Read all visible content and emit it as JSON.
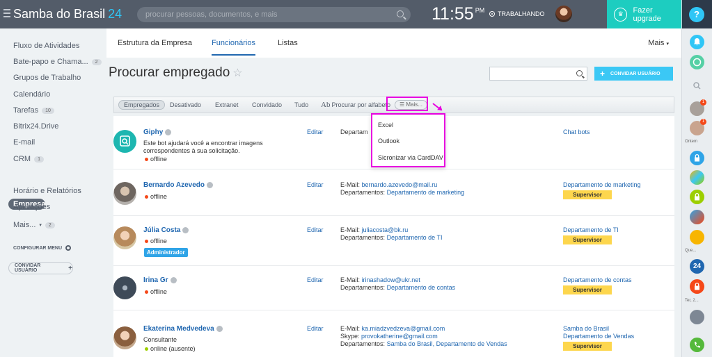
{
  "topbar": {
    "logo_name": "Samba do Brasil",
    "logo_num": "24",
    "search_placeholder": "procurar pessoas, documentos, e mais",
    "time": "11:55",
    "time_suffix": "PM",
    "work_status": "TRABALHANDO",
    "upgrade_label": "Fazer upgrade"
  },
  "rightbar": {
    "help": "?",
    "label_ontem": "Ontem",
    "label_que": "Que...",
    "label_ter": "Ter, 2...",
    "badge1": "1",
    "badge2": "1",
    "num24": "24"
  },
  "sidebar": {
    "items": [
      {
        "label": "Fluxo de Atividades",
        "count": ""
      },
      {
        "label": "Bate-papo e Chama...",
        "count": "2"
      },
      {
        "label": "Grupos de Trabalho",
        "count": ""
      },
      {
        "label": "Calendário",
        "count": ""
      },
      {
        "label": "Tarefas",
        "count": "10"
      },
      {
        "label": "Bitrix24.Drive",
        "count": ""
      },
      {
        "label": "E-mail",
        "count": ""
      },
      {
        "label": "CRM",
        "count": "1"
      },
      {
        "label": "Empresa",
        "count": ""
      },
      {
        "label": "Horário e Relatórios",
        "count": ""
      },
      {
        "label": "Aplicações",
        "count": ""
      },
      {
        "label": "Mais...",
        "count": "2"
      }
    ],
    "configure": "CONFIGURAR MENU",
    "invite": "CONVIDAR USUÁRIO"
  },
  "tabs": {
    "items": [
      "Estrutura da Empresa",
      "Funcionários",
      "Listas"
    ],
    "more": "Mais"
  },
  "page": {
    "title": "Procurar empregado",
    "invite_button": "CONVIDAR USUÁRIO"
  },
  "filters": {
    "items": [
      "Empregados",
      "Desativado",
      "Extranet",
      "Convidado",
      "Tudo"
    ],
    "alphabet": "Procurar por alfabeto",
    "more": "Mais..."
  },
  "dropdown": {
    "items": [
      "Excel",
      "Outlook",
      "Sicronizar via CardDAV"
    ]
  },
  "employees": [
    {
      "name": "Giphy",
      "desc": "Este bot ajudará você a encontrar imagens correspondentes à sua solicitação.",
      "status": "offline",
      "edit": "Editar",
      "dept_label": "Departam",
      "dept": "Chat bots"
    },
    {
      "name": "Bernardo Azevedo",
      "status": "offline",
      "edit": "Editar",
      "email_label": "E-Mail:",
      "email": "bernardo.azevedo@mail.ru",
      "depts_label": "Departamentos:",
      "depts": "Departamento de marketing",
      "dept": "Departamento de marketing",
      "badge": "Supervisor"
    },
    {
      "name": "Júlia Costa",
      "status": "offline",
      "role": "Administrador",
      "edit": "Editar",
      "email_label": "E-Mail:",
      "email": "juliacosta@bk.ru",
      "depts_label": "Departamentos:",
      "depts": "Departamento de TI",
      "dept": "Departamento de TI",
      "badge": "Supervisor"
    },
    {
      "name": "Irina Gr",
      "status": "offline",
      "edit": "Editar",
      "email_label": "E-Mail:",
      "email": "irinashadow@ukr.net",
      "depts_label": "Departamentos:",
      "depts": "Departamento de contas",
      "dept": "Departamento de contas",
      "badge": "Supervisor"
    },
    {
      "name": "Ekaterina Medvedeva",
      "position": "Consultante",
      "status": "online (ausente)",
      "edit": "Editar",
      "email_label": "E-Mail:",
      "email": "ka.miadzvedzeva@gmail.com",
      "skype_label": "Skype:",
      "skype": "provokatherine@gmail.com",
      "depts_label": "Departamentos:",
      "depts": "Samba do Brasil, Departamento de Vendas",
      "dept": "Samba do Brasil",
      "dept2": "Departamento de Vendas",
      "badge": "Supervisor"
    }
  ],
  "colors": {
    "topbar": "#535c69",
    "accent": "#2fc6f6",
    "upgrade": "#1dcdc0",
    "link": "#2067b0",
    "highlight": "#e800e0",
    "supervisor": "#fdd64d",
    "offline": "#f54819",
    "online": "#9dcf00"
  }
}
